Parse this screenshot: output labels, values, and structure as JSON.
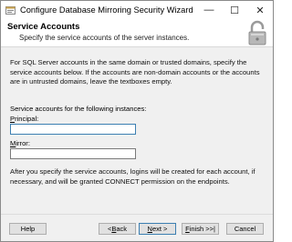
{
  "window": {
    "title": "Configure Database Mirroring Security Wizard",
    "controls": {
      "minimize": "—",
      "maximize": "☐",
      "close": "✕"
    }
  },
  "header": {
    "title": "Service Accounts",
    "subtitle": "Specify the service accounts of the server instances."
  },
  "body": {
    "intro": "For SQL Server accounts in the same domain or trusted domains, specify the service accounts below. If the accounts are non-domain accounts or the accounts are in untrusted domains, leave the textboxes empty.",
    "instances_label": "Service accounts for the following instances:",
    "principal": {
      "label_key": "P",
      "label_rest": "rincipal:",
      "value": ""
    },
    "mirror": {
      "label_key": "M",
      "label_rest": "irror:",
      "value": ""
    },
    "footer_note": "After you specify the service accounts, logins will be created for each account, if necessary, and will be granted CONNECT permission on the endpoints."
  },
  "buttons": {
    "help": "Help",
    "back_prefix": "< ",
    "back_key": "B",
    "back_rest": "ack",
    "next_key": "N",
    "next_rest": "ext >",
    "finish_key": "F",
    "finish_rest": "inish >>|",
    "cancel": "Cancel"
  },
  "colors": {
    "focus_border": "#3c7fb1",
    "dialog_bg": "#f0f0f0"
  },
  "icons": {
    "app": "wizard-icon",
    "header": "padlock-icon"
  }
}
